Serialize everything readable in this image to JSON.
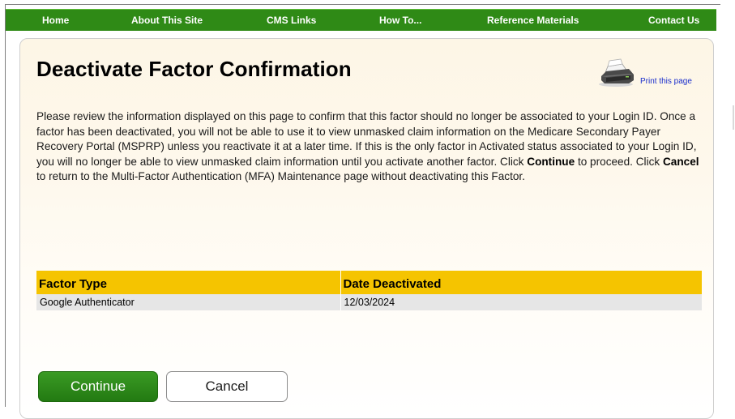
{
  "nav": {
    "items": [
      {
        "label": "Home"
      },
      {
        "label": "About This Site"
      },
      {
        "label": "CMS Links"
      },
      {
        "label": "How To..."
      },
      {
        "label": "Reference Materials"
      },
      {
        "label": "Contact Us"
      }
    ]
  },
  "page": {
    "title": "Deactivate Factor Confirmation",
    "print_label": "Print this page"
  },
  "description": {
    "paragraph": "Please review the information displayed on this page to confirm that this factor should no longer be associated to your Login ID. Once a factor has been deactivated, you will not be able to use it to view unmasked claim information on the Medicare Secondary Payer Recovery Portal (MSPRP) unless you reactivate it at a later time. If this is the only factor in Activated status associated to your Login ID, you will no longer be able to view unmasked claim information until you activate another factor.",
    "instruction_prefix": "Click",
    "continue_word": "Continue",
    "instruction_middle": "to proceed. Click",
    "cancel_word": "Cancel",
    "instruction_suffix": "to return to the Multi-Factor Authentication (MFA) Maintenance page without deactivating this Factor."
  },
  "table": {
    "headers": [
      "Factor Type",
      "Date Deactivated"
    ],
    "rows": [
      [
        "Google Authenticator",
        "12/03/2024"
      ]
    ]
  },
  "buttons": {
    "continue_label": "Continue",
    "cancel_label": "Cancel"
  },
  "colors": {
    "nav_green": "#2f8a16",
    "table_header_gold": "#f5c400",
    "link_blue": "#1a2ecc"
  },
  "icons": {
    "print": "printer-icon"
  }
}
